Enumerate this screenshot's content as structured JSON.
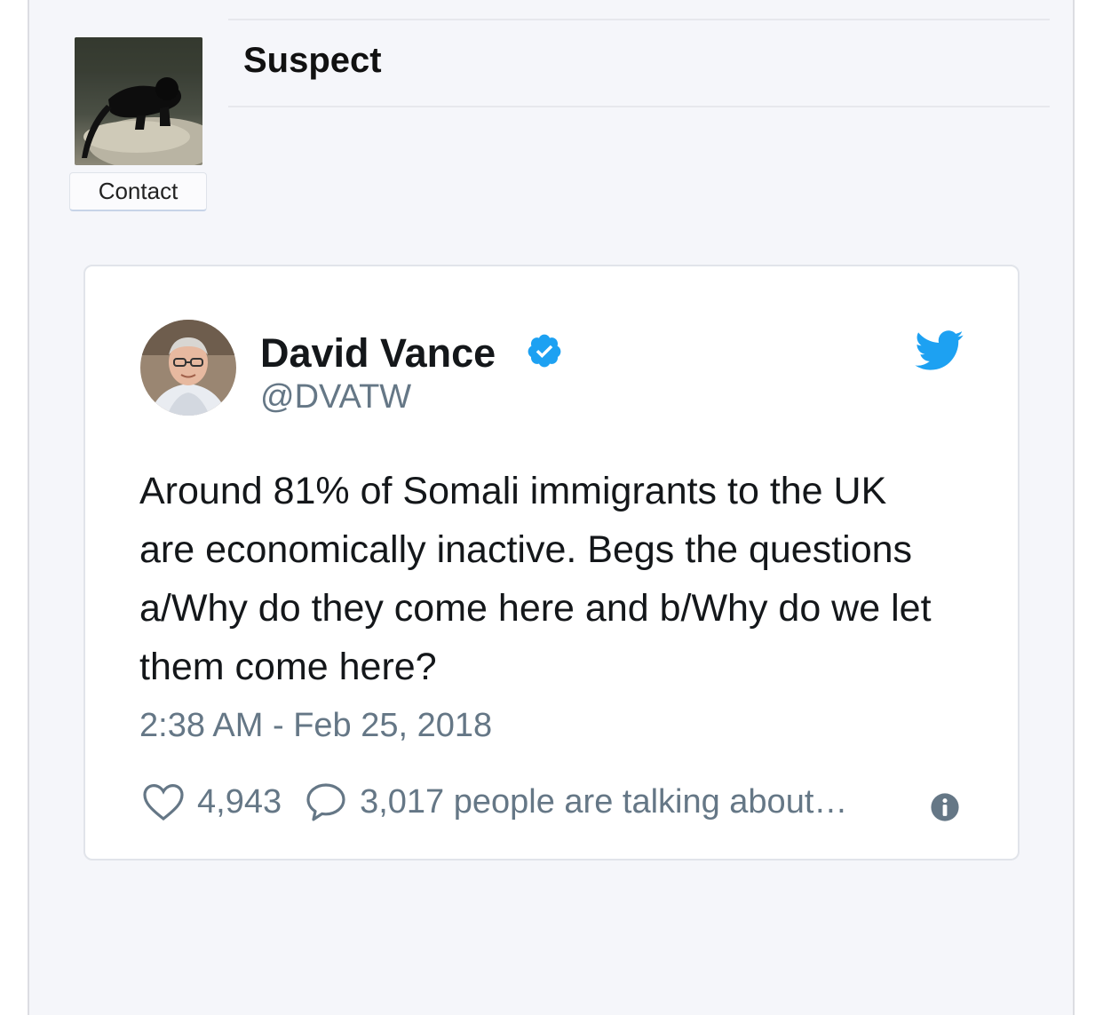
{
  "post": {
    "title": "Suspect",
    "contact_label": "Contact",
    "avatar_icon": "panther-photo"
  },
  "tweet": {
    "author_name": "David Vance",
    "handle": "@DVATW",
    "verified": true,
    "text": "Around 81% of Somali immigrants to the UK are economically inactive. Begs the questions a/Why do they come here and b/Why do we let them come here?",
    "timestamp": "2:38 AM - Feb 25, 2018",
    "likes": "4,943",
    "conversation": "3,017 people are talking about…",
    "brand_color": "#1da1f2"
  }
}
